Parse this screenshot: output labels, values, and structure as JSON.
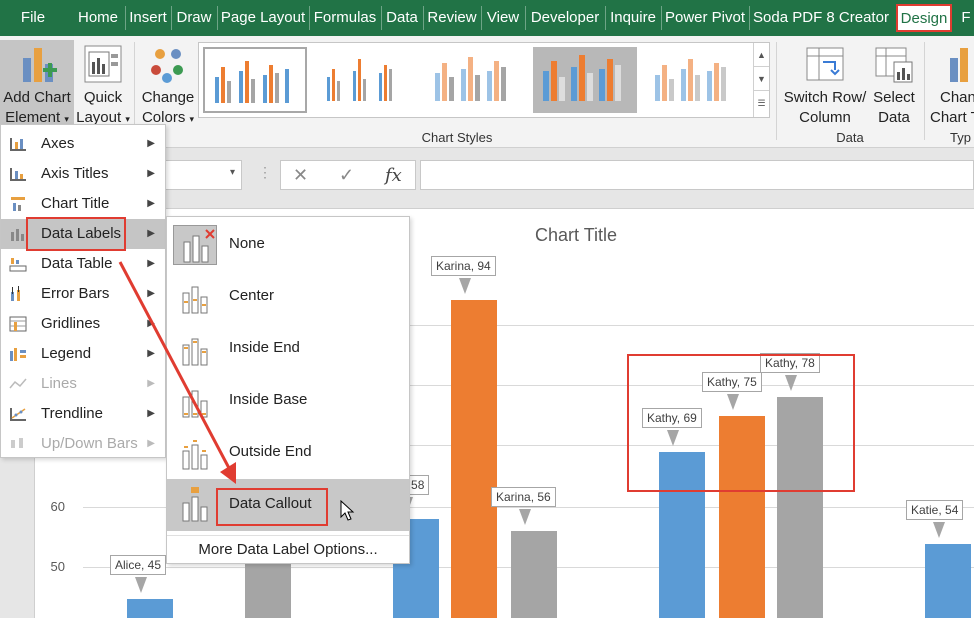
{
  "tabs": [
    "File",
    "Home",
    "Insert",
    "Draw",
    "Page Layout",
    "Formulas",
    "Data",
    "Review",
    "View",
    "Developer",
    "Inquire",
    "Power Pivot",
    "Soda PDF 8 Creator",
    "Design",
    "F"
  ],
  "ribbon": {
    "add_chart_element": {
      "line1": "Add Chart",
      "line2": "Element"
    },
    "quick_layout": {
      "line1": "Quick",
      "line2": "Layout"
    },
    "change_colors": {
      "line1": "Change",
      "line2": "Colors"
    },
    "chart_styles_label": "Chart Styles",
    "switch_row_column": {
      "line1": "Switch Row/",
      "line2": "Column"
    },
    "select_data": {
      "line1": "Select",
      "line2": "Data"
    },
    "data_group_label": "Data",
    "change_chart_type": {
      "line1": "Chan",
      "line2": "Chart T"
    },
    "type_group_label": "Typ"
  },
  "formula_bar": {
    "fx": "fx",
    "cancel": "✕",
    "enter": "✓"
  },
  "chart": {
    "title": "Chart Title",
    "y_ticks": [
      "60",
      "50"
    ],
    "accent_blue": "#5b9bd5",
    "accent_orange": "#ed7d31",
    "accent_gray": "#a5a5a5"
  },
  "chart_data": {
    "type": "bar",
    "title": "Chart Title",
    "visible_y_ticks": [
      60,
      50
    ],
    "series_colors": [
      "#5b9bd5",
      "#ed7d31",
      "#a5a5a5"
    ],
    "bars": [
      {
        "label": "Alice, 45",
        "value": 45,
        "color": "#5b9bd5"
      },
      {
        "label": "",
        "value": 52,
        "color": "#a5a5a5"
      },
      {
        "label": "na, 58",
        "value": 58,
        "color": "#5b9bd5"
      },
      {
        "label": "Karina, 94",
        "value": 94,
        "color": "#ed7d31"
      },
      {
        "label": "Karina, 56",
        "value": 56,
        "color": "#a5a5a5"
      },
      {
        "label": "Kathy, 69",
        "value": 69,
        "color": "#5b9bd5"
      },
      {
        "label": "Kathy, 75",
        "value": 75,
        "color": "#ed7d31"
      },
      {
        "label": "Kathy, 78",
        "value": 78,
        "color": "#a5a5a5"
      },
      {
        "label": "Katie, 54",
        "value": 54,
        "color": "#5b9bd5"
      }
    ]
  },
  "menu1": {
    "items": [
      {
        "label": "Axes",
        "disabled": false
      },
      {
        "label": "Axis Titles",
        "disabled": false
      },
      {
        "label": "Chart Title",
        "disabled": false
      },
      {
        "label": "Data Labels",
        "disabled": false
      },
      {
        "label": "Data Table",
        "disabled": false
      },
      {
        "label": "Error Bars",
        "disabled": false
      },
      {
        "label": "Gridlines",
        "disabled": false
      },
      {
        "label": "Legend",
        "disabled": false
      },
      {
        "label": "Lines",
        "disabled": true
      },
      {
        "label": "Trendline",
        "disabled": false
      },
      {
        "label": "Up/Down Bars",
        "disabled": true
      }
    ]
  },
  "menu2": {
    "items": [
      "None",
      "Center",
      "Inside End",
      "Inside Base",
      "Outside End",
      "Data Callout"
    ],
    "more": "More Data Label Options..."
  }
}
